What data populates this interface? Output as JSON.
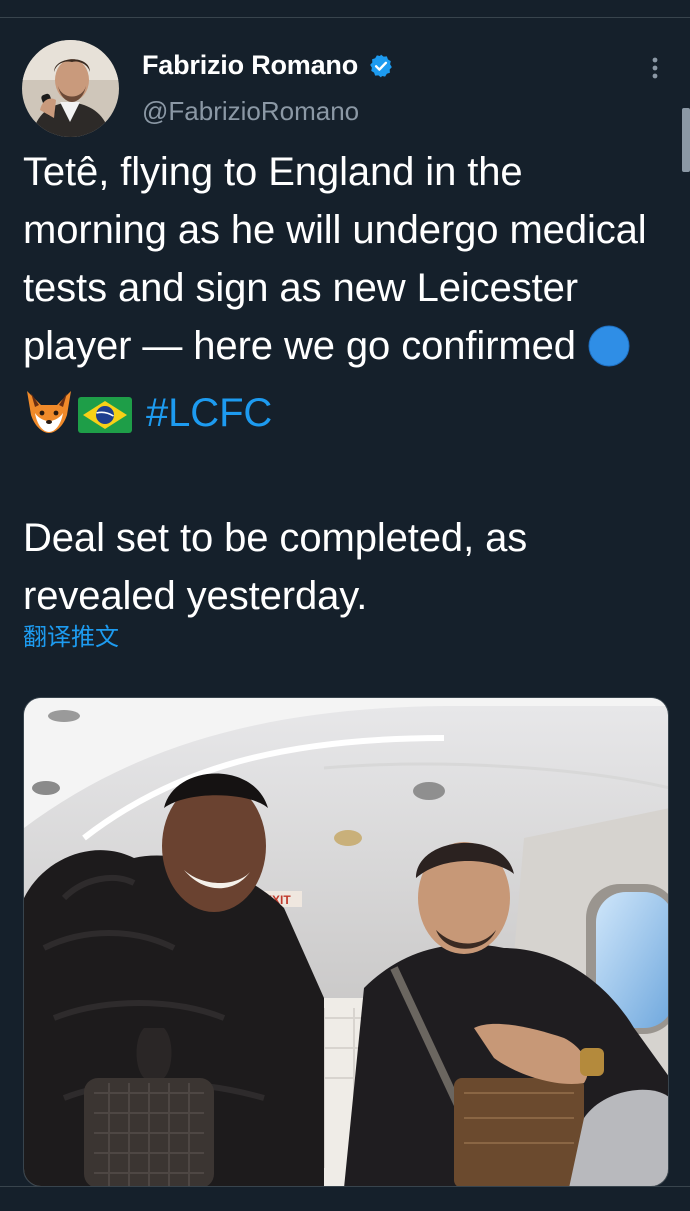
{
  "author": {
    "display_name": "Fabrizio Romano",
    "handle": "@FabrizioRomano",
    "verified": true
  },
  "tweet": {
    "paragraph1": "Tetê, flying to England in the morning as he will undergo medical tests and sign as new Leicester player — here we go confirmed",
    "emojis": [
      "blue-circle-emoji",
      "fox-emoji",
      "brazil-flag-emoji"
    ],
    "hashtag": "#LCFC",
    "paragraph2": "Deal set to be completed, as revealed yesterday."
  },
  "translate_label": "翻译推文",
  "media": {
    "exit_sign_text": "EXIT"
  },
  "colors": {
    "background": "#15202b",
    "accent": "#1d9bf0",
    "secondary_text": "#8b98a5",
    "divider": "#38444d"
  }
}
